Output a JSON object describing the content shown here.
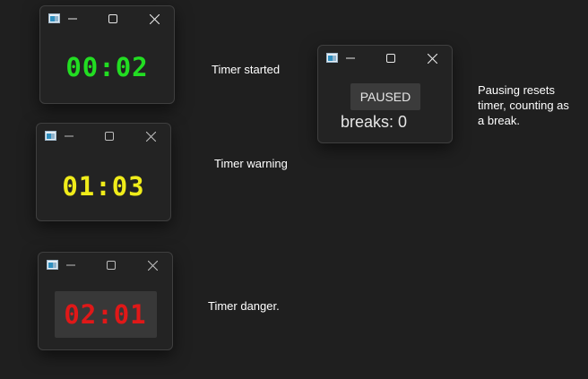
{
  "windows": [
    {
      "id": "started",
      "timer": "00:02",
      "color": "#22dd22",
      "caption": "Timer started"
    },
    {
      "id": "warning",
      "timer": "01:03",
      "color": "#f0ec1a",
      "caption": "Timer warning"
    },
    {
      "id": "danger",
      "timer": "02:01",
      "color": "#e01818",
      "caption": "Timer danger."
    }
  ],
  "paused": {
    "button_label": "PAUSED",
    "breaks_text": "breaks: 0",
    "caption": "Pausing resets timer, counting as a break."
  },
  "icons": {
    "app": "app-icon",
    "minimize": "minimize-icon",
    "maximize": "maximize-icon",
    "close": "close-icon"
  }
}
